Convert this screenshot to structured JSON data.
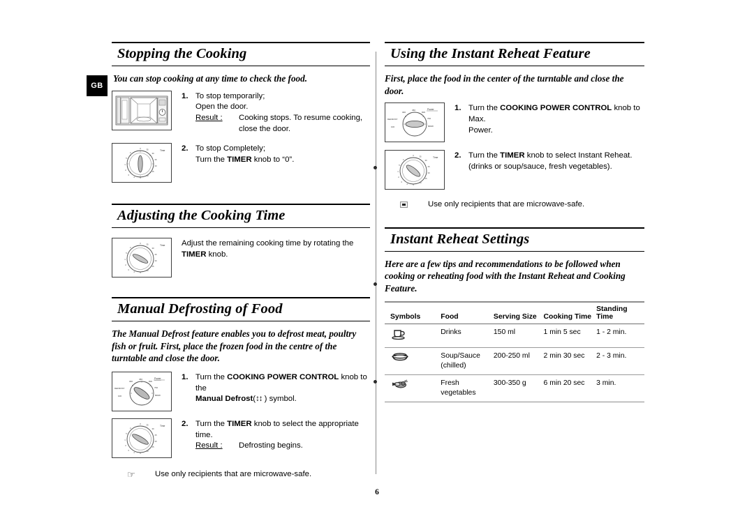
{
  "page": {
    "language_tab": "GB",
    "page_number": "6"
  },
  "left_column": {
    "sections": [
      {
        "heading": "Stopping the Cooking",
        "lead": "You can stop cooking at any time to check the food.",
        "steps": [
          {
            "number": "1.",
            "figure": "microwave-oven-open-door",
            "text_lines": [
              "To stop temporarily;",
              "Open the door."
            ],
            "result_label": "Result :",
            "result_text": "Cooking stops. To resume cooking, close the door."
          },
          {
            "number": "2.",
            "figure": "timer-knob-zero",
            "text_lines": [
              "To stop Completely;",
              "Turn the TIMER knob to “0”."
            ],
            "bold_terms": [
              "TIMER"
            ]
          }
        ]
      },
      {
        "heading": "Adjusting the Cooking Time",
        "steps": [
          {
            "figure": "timer-knob-adjust",
            "text": "Adjust the remaining cooking time by rotating the TIMER knob.",
            "bold_terms": [
              "TIMER"
            ]
          }
        ]
      },
      {
        "heading": "Manual Defrosting of Food",
        "lead": "The Manual Defrost feature enables you to defrost meat, poultry fish or fruit. First, place the frozen food in the centre of the turntable and close the door.",
        "steps": [
          {
            "number": "1.",
            "figure": "power-knob-defrost",
            "text": "Turn the COOKING POWER CONTROL knob to the Manual Defrost(↕) symbol.",
            "bold_terms": [
              "COOKING POWER CONTROL",
              "Manual Defrost"
            ]
          },
          {
            "number": "2.",
            "figure": "timer-knob-defrost",
            "text": "Turn the TIMER knob to select the appropriate time.",
            "bold_terms": [
              "TIMER"
            ],
            "result_label": "Result :",
            "result_text": "Defrosting begins."
          }
        ],
        "note": {
          "glyph": "pointing-hand",
          "text": "Use only recipients that are microwave-safe."
        }
      }
    ]
  },
  "right_column": {
    "sections": [
      {
        "heading": "Using the Instant Reheat Feature",
        "lead": "First, place the food in the center of the turntable and close the door.",
        "steps": [
          {
            "number": "1.",
            "figure": "power-knob-max",
            "text": "Turn the COOKING POWER CONTROL knob to Max. Power.",
            "bold_terms": [
              "COOKING POWER CONTROL"
            ]
          },
          {
            "number": "2.",
            "figure": "timer-knob-reheat",
            "text": "Turn the TIMER knob to select Instant Reheat. (drinks or soup/sauce, fresh vegetables).",
            "bold_terms": [
              "TIMER"
            ]
          }
        ],
        "note": {
          "glyph": "small-square",
          "text": "Use only recipients that are microwave-safe."
        }
      },
      {
        "heading": "Instant Reheat Settings",
        "lead": "Here are a few tips and recommendations to be followed when cooking or reheating food with the Instant Reheat and Cooking Feature."
      }
    ],
    "table": {
      "columns": [
        "Symbols",
        "Food",
        "Serving Size",
        "Cooking Time",
        "Standing Time"
      ],
      "rows": [
        {
          "symbol": "cup-saucer-icon",
          "food": "Drinks",
          "serving_size": "150 ml",
          "cooking_time": "1 min 5 sec",
          "standing_time": "1 - 2 min."
        },
        {
          "symbol": "covered-bowl-icon",
          "food": "Soup/Sauce (chilled)",
          "serving_size": "200-250 ml",
          "cooking_time": "2 min 30 sec",
          "standing_time": "2 - 3 min."
        },
        {
          "symbol": "vegetables-icon",
          "food": "Fresh vegetables",
          "serving_size": "300-350 g",
          "cooking_time": "6 min 20 sec",
          "standing_time": "3 min."
        }
      ]
    }
  },
  "figure_labels": {
    "power_dial": [
      "DEFROST",
      "100",
      "300",
      "450",
      "600",
      "700",
      "800W",
      "Power"
    ],
    "timer_dial": [
      "Time",
      "0",
      "1",
      "2",
      "3",
      "4",
      "5",
      "10",
      "15",
      "20",
      "25",
      "30",
      "35"
    ]
  }
}
